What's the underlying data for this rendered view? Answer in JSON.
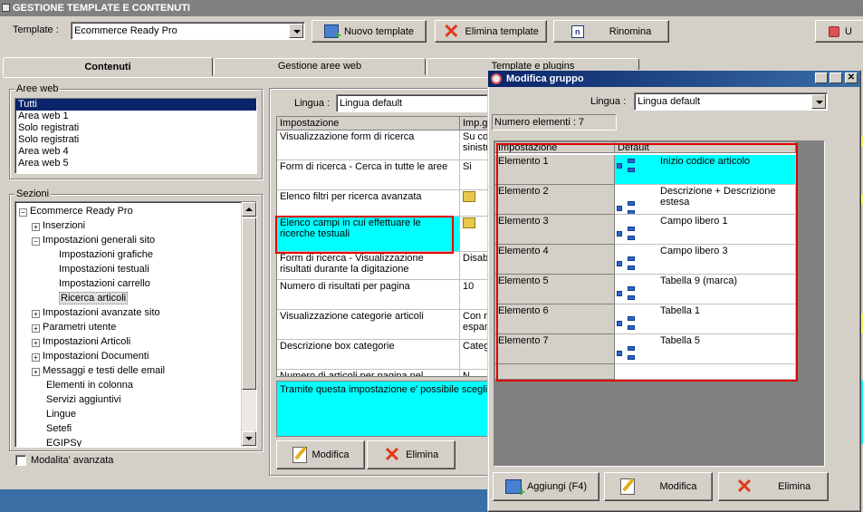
{
  "window": {
    "title": "GESTIONE TEMPLATE E CONTENUTI"
  },
  "toolbar": {
    "template_label": "Template :",
    "template_value": "Ecommerce Ready Pro",
    "new_template": "Nuovo template",
    "delete_template": "Elimina template",
    "rename": "Rinomina",
    "right_button_fragment": "U"
  },
  "tabs": [
    {
      "label": "Contenuti",
      "active": true
    },
    {
      "label": "Gestione aree web",
      "active": false
    },
    {
      "label": "Template e plugins",
      "active": false
    }
  ],
  "aree_web": {
    "label": "Aree web",
    "items": [
      "Tutti",
      "Area web 1",
      "Solo registrati",
      "Solo registrati",
      "Area web 4",
      "Area web 5"
    ],
    "selected_index": 0
  },
  "sezioni": {
    "label": "Sezioni",
    "nodes": [
      {
        "label": "Ecommerce Ready Pro",
        "level": 0,
        "expander": "-"
      },
      {
        "label": "Inserzioni",
        "level": 1,
        "expander": "+"
      },
      {
        "label": "Impostazioni generali sito",
        "level": 1,
        "expander": "-"
      },
      {
        "label": "Impostazioni grafiche",
        "level": 2,
        "expander": ""
      },
      {
        "label": "Impostazioni testuali",
        "level": 2,
        "expander": ""
      },
      {
        "label": "Impostazioni carrello",
        "level": 2,
        "expander": ""
      },
      {
        "label": "Ricerca articoli",
        "level": 2,
        "expander": "",
        "selected": true
      },
      {
        "label": "Impostazioni avanzate sito",
        "level": 1,
        "expander": "+"
      },
      {
        "label": "Parametri utente",
        "level": 1,
        "expander": "+"
      },
      {
        "label": "Impostazioni Articoli",
        "level": 1,
        "expander": "+"
      },
      {
        "label": "Impostazioni Documenti",
        "level": 1,
        "expander": "+"
      },
      {
        "label": "Messaggi e testi delle email",
        "level": 1,
        "expander": "+"
      },
      {
        "label": "Elementi in colonna",
        "level": 1,
        "expander": ""
      },
      {
        "label": "Servizi aggiuntivi",
        "level": 1,
        "expander": ""
      },
      {
        "label": "Lingue",
        "level": 1,
        "expander": ""
      },
      {
        "label": "Setefi",
        "level": 1,
        "expander": ""
      },
      {
        "label": "EGIPSy",
        "level": 1,
        "expander": ""
      }
    ]
  },
  "advanced_mode": "Modalita' avanzata",
  "main": {
    "lingua_label": "Lingua :",
    "lingua_value": "Lingua default",
    "col_setting": "Impostazione",
    "col_value": "Imp.g",
    "rows": [
      {
        "setting": "Visualizzazione form di ricerca",
        "value": "Su co sinistr"
      },
      {
        "setting": "Form di ricerca - Cerca in tutte le aree",
        "value": "Si"
      },
      {
        "setting": "Elenco filtri per ricerca avanzata",
        "value": ""
      },
      {
        "setting": "Elenco campi in cui effettuare le ricerche testuali",
        "value": ""
      },
      {
        "setting": "Form di ricerca - Visualizzazione risultati durante la digitazione",
        "value": "Disab"
      },
      {
        "setting": "Numero di risultati per pagina",
        "value": "10"
      },
      {
        "setting": "Visualizzazione categorie articoli",
        "value": "Con n espan"
      },
      {
        "setting": "Descrizione box categorie",
        "value": "Categ"
      },
      {
        "setting": "Numero di articoli per pagina nel catalogo",
        "value": "N"
      }
    ],
    "description": "Tramite questa impostazione e' possibile sceglie",
    "edit": "Modifica",
    "delete": "Elimina"
  },
  "dialog": {
    "title": "Modifica gruppo",
    "lingua_label": "Lingua :",
    "lingua_value": "Lingua default",
    "count": "Numero elementi : 7",
    "col_setting": "Impostazione",
    "col_default": "Default",
    "rows": [
      {
        "key": "Elemento 1",
        "value": "Inizio codice articolo"
      },
      {
        "key": "Elemento 2",
        "value": "Descrizione + Descrizione estesa"
      },
      {
        "key": "Elemento 3",
        "value": "Campo libero 1"
      },
      {
        "key": "Elemento 4",
        "value": "Campo libero 3"
      },
      {
        "key": "Elemento 5",
        "value": "Tabella 9 (marca)"
      },
      {
        "key": "Elemento 6",
        "value": "Tabella 1"
      },
      {
        "key": "Elemento 7",
        "value": "Tabella 5"
      }
    ],
    "add": "Aggiungi (F4)",
    "edit": "Modifica",
    "delete": "Elimina"
  },
  "colors": {
    "highlight": "#00ffff",
    "selection": "#0a246a",
    "annotation": "#e00000",
    "accent_green": "#2eaa2e"
  }
}
